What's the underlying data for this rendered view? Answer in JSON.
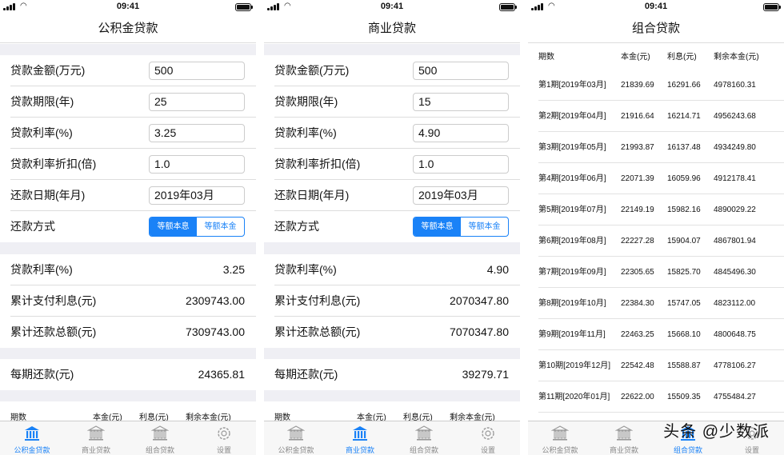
{
  "status": {
    "time": "09:41"
  },
  "tabs": [
    "公积金贷款",
    "商业贷款",
    "组合贷款",
    "设置"
  ],
  "accent_color": "#1a82f7",
  "phones": [
    {
      "title": "公积金贷款",
      "inputs": [
        {
          "label": "贷款金额(万元)",
          "value": "500"
        },
        {
          "label": "贷款期限(年)",
          "value": "25"
        },
        {
          "label": "贷款利率(%)",
          "value": "3.25"
        },
        {
          "label": "贷款利率折扣(倍)",
          "value": "1.0"
        },
        {
          "label": "还款日期(年月)",
          "value": "2019年03月"
        }
      ],
      "method_label": "还款方式",
      "method_options": [
        "等额本息",
        "等额本金"
      ],
      "results": [
        {
          "label": "贷款利率(%)",
          "value": "3.25"
        },
        {
          "label": "累计支付利息(元)",
          "value": "2309743.00"
        },
        {
          "label": "累计还款总额(元)",
          "value": "7309743.00"
        }
      ],
      "monthly": {
        "label": "每期还款(元)",
        "value": "24365.81"
      },
      "table_header": [
        "期数",
        "本金(元)",
        "利息(元)",
        "剩余本金(元)"
      ]
    },
    {
      "title": "商业贷款",
      "inputs": [
        {
          "label": "贷款金额(万元)",
          "value": "500"
        },
        {
          "label": "贷款期限(年)",
          "value": "15"
        },
        {
          "label": "贷款利率(%)",
          "value": "4.90"
        },
        {
          "label": "贷款利率折扣(倍)",
          "value": "1.0"
        },
        {
          "label": "还款日期(年月)",
          "value": "2019年03月"
        }
      ],
      "method_label": "还款方式",
      "method_options": [
        "等额本息",
        "等额本金"
      ],
      "results": [
        {
          "label": "贷款利率(%)",
          "value": "4.90"
        },
        {
          "label": "累计支付利息(元)",
          "value": "2070347.80"
        },
        {
          "label": "累计还款总额(元)",
          "value": "7070347.80"
        }
      ],
      "monthly": {
        "label": "每期还款(元)",
        "value": "39279.71"
      },
      "table_header": [
        "期数",
        "本金(元)",
        "利息(元)",
        "剩余本金(元)"
      ]
    },
    {
      "title": "组合贷款",
      "table_header": [
        "期数",
        "本金(元)",
        "利息(元)",
        "剩余本金(元)"
      ],
      "rows": [
        [
          "第1期[2019年03月]",
          "21839.69",
          "16291.66",
          "4978160.31"
        ],
        [
          "第2期[2019年04月]",
          "21916.64",
          "16214.71",
          "4956243.68"
        ],
        [
          "第3期[2019年05月]",
          "21993.87",
          "16137.48",
          "4934249.80"
        ],
        [
          "第4期[2019年06月]",
          "22071.39",
          "16059.96",
          "4912178.41"
        ],
        [
          "第5期[2019年07月]",
          "22149.19",
          "15982.16",
          "4890029.22"
        ],
        [
          "第6期[2019年08月]",
          "22227.28",
          "15904.07",
          "4867801.94"
        ],
        [
          "第7期[2019年09月]",
          "22305.65",
          "15825.70",
          "4845496.30"
        ],
        [
          "第8期[2019年10月]",
          "22384.30",
          "15747.05",
          "4823112.00"
        ],
        [
          "第9期[2019年11月]",
          "22463.25",
          "15668.10",
          "4800648.75"
        ],
        [
          "第10期[2019年12月]",
          "22542.48",
          "15588.87",
          "4778106.27"
        ],
        [
          "第11期[2020年01月]",
          "22622.00",
          "15509.35",
          "4755484.27"
        ]
      ]
    }
  ],
  "watermark": "头条 @少数派"
}
